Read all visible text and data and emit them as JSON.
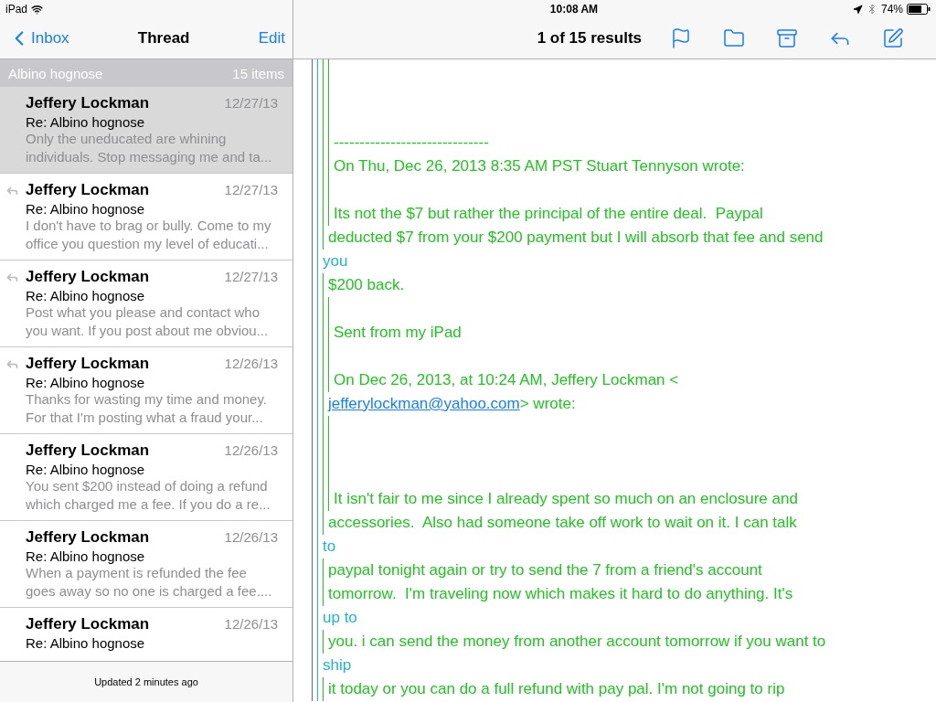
{
  "status_bar": {
    "device": "iPad",
    "time": "10:08 AM",
    "battery": "74%"
  },
  "nav": {
    "back": "Inbox",
    "title": "Thread",
    "action": "Edit"
  },
  "toolbar": {
    "results": "1 of 15 results"
  },
  "group": {
    "title": "Albino hognose",
    "count": "15 items"
  },
  "messages": [
    {
      "sender": "Jeffery Lockman",
      "date": "12/27/13",
      "subject": "Re: Albino hognose",
      "preview": [
        "Only the uneducated are whining",
        "individuals. Stop messaging me and ta..."
      ],
      "replied": false,
      "selected": true
    },
    {
      "sender": "Jeffery Lockman",
      "date": "12/27/13",
      "subject": "Re: Albino hognose",
      "preview": [
        "I don't have to brag or bully. Come to my",
        "office you question my level of educati..."
      ],
      "replied": true,
      "selected": false
    },
    {
      "sender": "Jeffery Lockman",
      "date": "12/27/13",
      "subject": "Re: Albino hognose",
      "preview": [
        "Post what you please and contact who",
        "you want. If you post about me obviou..."
      ],
      "replied": true,
      "selected": false
    },
    {
      "sender": "Jeffery Lockman",
      "date": "12/26/13",
      "subject": "Re: Albino hognose",
      "preview": [
        "Thanks for wasting my time and money.",
        "For that I'm posting what a fraud your..."
      ],
      "replied": true,
      "selected": false
    },
    {
      "sender": "Jeffery Lockman",
      "date": "12/26/13",
      "subject": "Re: Albino hognose",
      "preview": [
        "You sent $200 instead of doing a refund",
        "which charged me a fee. If you do a re..."
      ],
      "replied": false,
      "selected": false
    },
    {
      "sender": "Jeffery Lockman",
      "date": "12/26/13",
      "subject": "Re: Albino hognose",
      "preview": [
        "When a payment is refunded the fee",
        "goes away so no one is charged a fee...."
      ],
      "replied": false,
      "selected": false
    },
    {
      "sender": "Jeffery Lockman",
      "date": "12/26/13",
      "subject": "Re: Albino hognose",
      "replied": false,
      "selected": false
    }
  ],
  "footer": "Updated 2 minutes ago",
  "body": [
    {
      "kind": "gap"
    },
    {
      "kind": "gap"
    },
    {
      "kind": "gap"
    },
    {
      "kind": "deep",
      "text": "------------------------------"
    },
    {
      "kind": "deep",
      "text": "On Thu, Dec 26, 2013 8:35 AM PST Stuart Tennyson wrote:"
    },
    {
      "kind": "gap"
    },
    {
      "kind": "deep",
      "text": "Its not the $7 but rather the principal of the entire deal.  Paypal"
    },
    {
      "kind": "quote",
      "text": "deducted $7 from your $200 payment but I will absorb that fee and send"
    },
    {
      "kind": "outer",
      "text": "you"
    },
    {
      "kind": "quote",
      "text": "$200 back."
    },
    {
      "kind": "gap"
    },
    {
      "kind": "deep",
      "text": "Sent from my iPad"
    },
    {
      "kind": "gap"
    },
    {
      "kind": "deep",
      "text": "On Dec 26, 2013, at 10:24 AM, Jeffery Lockman <"
    },
    {
      "kind": "link",
      "link": "jefferylockman@yahoo.com",
      "text": "> wrote:"
    },
    {
      "kind": "gap"
    },
    {
      "kind": "gap"
    },
    {
      "kind": "gap"
    },
    {
      "kind": "deep",
      "text": "It isn't fair to me since I already spent so much on an enclosure and"
    },
    {
      "kind": "quote",
      "text": "accessories.  Also had someone take off work to wait on it. I can talk"
    },
    {
      "kind": "outer",
      "text": "to"
    },
    {
      "kind": "quote",
      "text": "paypal tonight again or try to send the 7 from a friend's account"
    },
    {
      "kind": "quote",
      "text": "tomorrow.  I'm traveling now which makes it hard to do anything. It's"
    },
    {
      "kind": "outer",
      "text": "up to"
    },
    {
      "kind": "quote",
      "text": "you. i can send the money from another account tomorrow if you want to"
    },
    {
      "kind": "outer",
      "text": "ship"
    },
    {
      "kind": "quote",
      "text": "it today or you can do a full refund with pay pal. I'm not going to rip"
    }
  ]
}
